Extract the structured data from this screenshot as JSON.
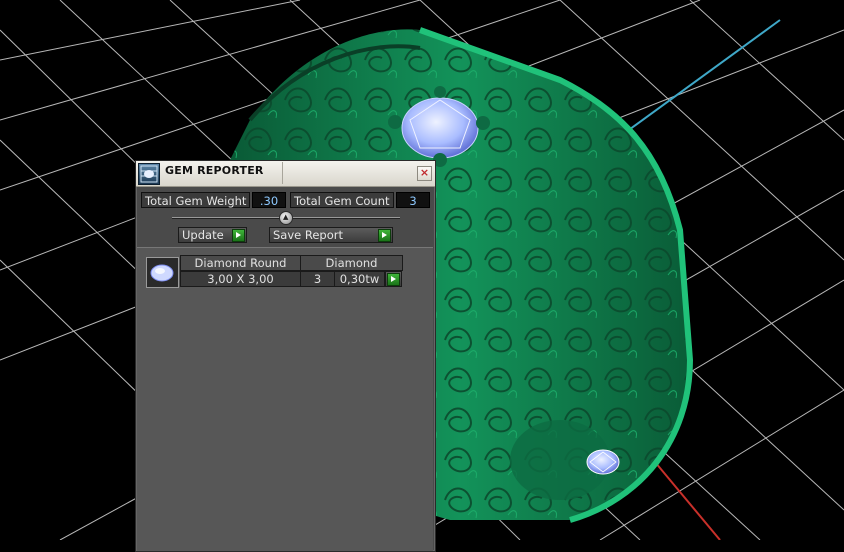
{
  "viewport": {
    "background": "#000000",
    "grid_color": "#e8e8e8",
    "ring_color": "#0f7a4a",
    "gem_color": "#9fb4ff"
  },
  "panel": {
    "title": "GEM REPORTER",
    "close_glyph": "×",
    "total_weight_label": "Total Gem Weight",
    "total_weight_value": ".30",
    "total_count_label": "Total Gem Count",
    "total_count_value": "3",
    "update_label": "Update",
    "save_report_label": "Save Report",
    "gem_rows": [
      {
        "shape": "Diamond Round",
        "material": "Diamond",
        "size": "3,00 X 3,00",
        "count": "3",
        "weight": "0,30tw"
      }
    ]
  }
}
